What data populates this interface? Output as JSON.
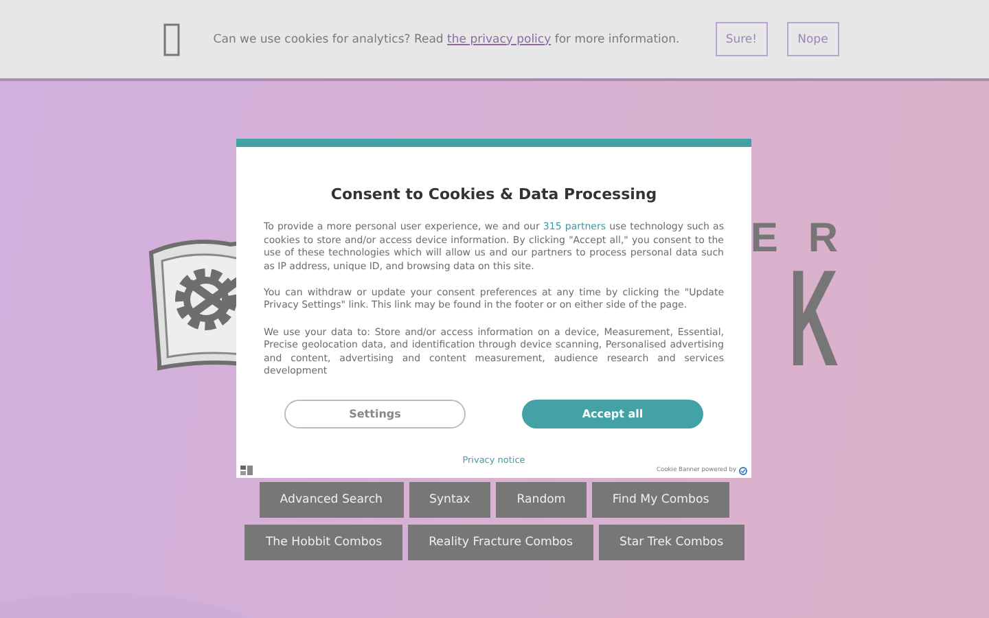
{
  "cookie_bar": {
    "text_before": "Can we use cookies for analytics? Read ",
    "link": "the privacy policy",
    "text_after": " for more information.",
    "buttons": [
      "Sure!",
      "Nope"
    ]
  },
  "logo": {
    "top_letters": [
      "E",
      "R"
    ],
    "big_letters": "K"
  },
  "consent_dialog": {
    "title": "Consent to Cookies & Data Processing",
    "paragraphs": [
      {
        "before": "To provide a more personal user experience, we and our ",
        "link": "315 partners",
        "after": " use technology such as cookies to store and/or access device information. By clicking \"Accept all,\" you consent to the use of these technologies which will allow us and our partners to process personal data such as IP address, unique ID, and browsing data on this site."
      },
      {
        "before": "You can withdraw or update your consent preferences at any time by clicking the \"Update Privacy Settings\" link. This link may be found in the footer or on either side of the page."
      },
      {
        "before": "We use your data to: Store and/or access information on a device, Measurement, Essential, Precise geolocation data, and identification through device scanning, Personalised advertising and content, advertising and content measurement, audience research and services development"
      }
    ],
    "buttons": [
      {
        "label": "Settings",
        "kind": "outline"
      },
      {
        "label": "Accept all",
        "kind": "primary"
      }
    ],
    "privacy_link": "Privacy notice",
    "powered_by": "Cookie Banner powered by"
  },
  "nav_buttons": [
    [
      "Advanced Search",
      "Syntax",
      "Random",
      "Find My Combos"
    ],
    [
      "The Hobbit Combos",
      "Reality Fracture Combos",
      "Star Trek Combos"
    ]
  ]
}
